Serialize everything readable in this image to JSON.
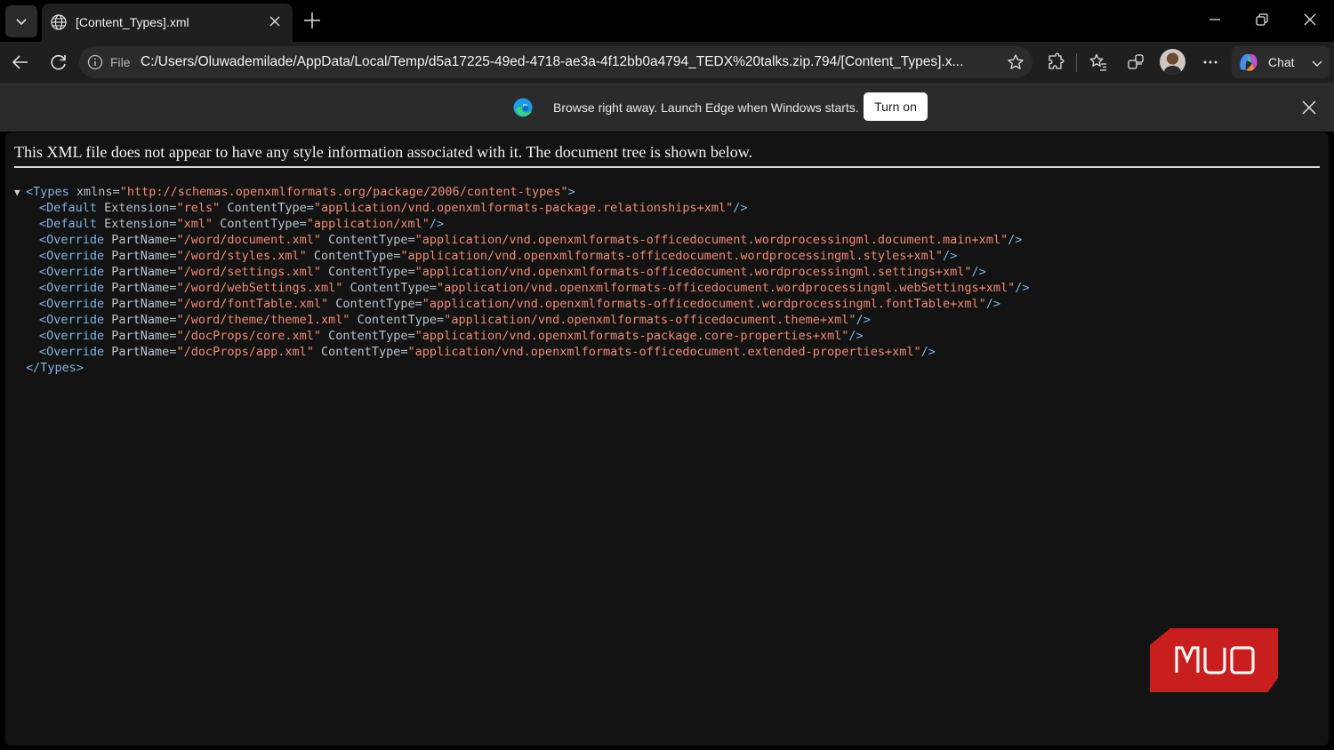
{
  "browser": {
    "tab": {
      "title": "[Content_Types].xml"
    },
    "address": {
      "scheme_label": "File",
      "url": "C:/Users/Oluwademilade/AppData/Local/Temp/d5a17225-49ed-4718-ae3a-4f12bb0a4794_TEDX%20talks.zip.794/[Content_Types].x..."
    },
    "chat_label": "Chat",
    "infobar": {
      "message": "Browse right away. Launch Edge when Windows starts.",
      "button_label": "Turn on"
    }
  },
  "xml": {
    "header": "This XML file does not appear to have any style information associated with it. The document tree is shown below.",
    "root_open": {
      "tag": "<Types",
      "attr": " xmlns=",
      "value": "\"http://schemas.openxmlformats.org/package/2006/content-types\"",
      "end": ">"
    },
    "lines": [
      {
        "tag": "<Default",
        "a1": " Extension=",
        "v1": "\"rels\"",
        "a2": " ContentType=",
        "v2": "\"application/vnd.openxmlformats-package.relationships+xml\"",
        "end": "/>"
      },
      {
        "tag": "<Default",
        "a1": " Extension=",
        "v1": "\"xml\"",
        "a2": " ContentType=",
        "v2": "\"application/xml\"",
        "end": "/>"
      },
      {
        "tag": "<Override",
        "a1": " PartName=",
        "v1": "\"/word/document.xml\"",
        "a2": " ContentType=",
        "v2": "\"application/vnd.openxmlformats-officedocument.wordprocessingml.document.main+xml\"",
        "end": "/>"
      },
      {
        "tag": "<Override",
        "a1": " PartName=",
        "v1": "\"/word/styles.xml\"",
        "a2": " ContentType=",
        "v2": "\"application/vnd.openxmlformats-officedocument.wordprocessingml.styles+xml\"",
        "end": "/>"
      },
      {
        "tag": "<Override",
        "a1": " PartName=",
        "v1": "\"/word/settings.xml\"",
        "a2": " ContentType=",
        "v2": "\"application/vnd.openxmlformats-officedocument.wordprocessingml.settings+xml\"",
        "end": "/>"
      },
      {
        "tag": "<Override",
        "a1": " PartName=",
        "v1": "\"/word/webSettings.xml\"",
        "a2": " ContentType=",
        "v2": "\"application/vnd.openxmlformats-officedocument.wordprocessingml.webSettings+xml\"",
        "end": "/>"
      },
      {
        "tag": "<Override",
        "a1": " PartName=",
        "v1": "\"/word/fontTable.xml\"",
        "a2": " ContentType=",
        "v2": "\"application/vnd.openxmlformats-officedocument.wordprocessingml.fontTable+xml\"",
        "end": "/>"
      },
      {
        "tag": "<Override",
        "a1": " PartName=",
        "v1": "\"/word/theme/theme1.xml\"",
        "a2": " ContentType=",
        "v2": "\"application/vnd.openxmlformats-officedocument.theme+xml\"",
        "end": "/>"
      },
      {
        "tag": "<Override",
        "a1": " PartName=",
        "v1": "\"/docProps/core.xml\"",
        "a2": " ContentType=",
        "v2": "\"application/vnd.openxmlformats-package.core-properties+xml\"",
        "end": "/>"
      },
      {
        "tag": "<Override",
        "a1": " PartName=",
        "v1": "\"/docProps/app.xml\"",
        "a2": " ContentType=",
        "v2": "\"application/vnd.openxmlformats-officedocument.extended-properties+xml\"",
        "end": "/>"
      }
    ],
    "root_close": "</Types>"
  },
  "watermark": {
    "text": "MUO",
    "color": "#c81e1e"
  },
  "colors": {
    "tag": "#7fb2e8",
    "value": "#f08a74",
    "attr": "#b9c3d0",
    "page_bg": "#131313"
  }
}
